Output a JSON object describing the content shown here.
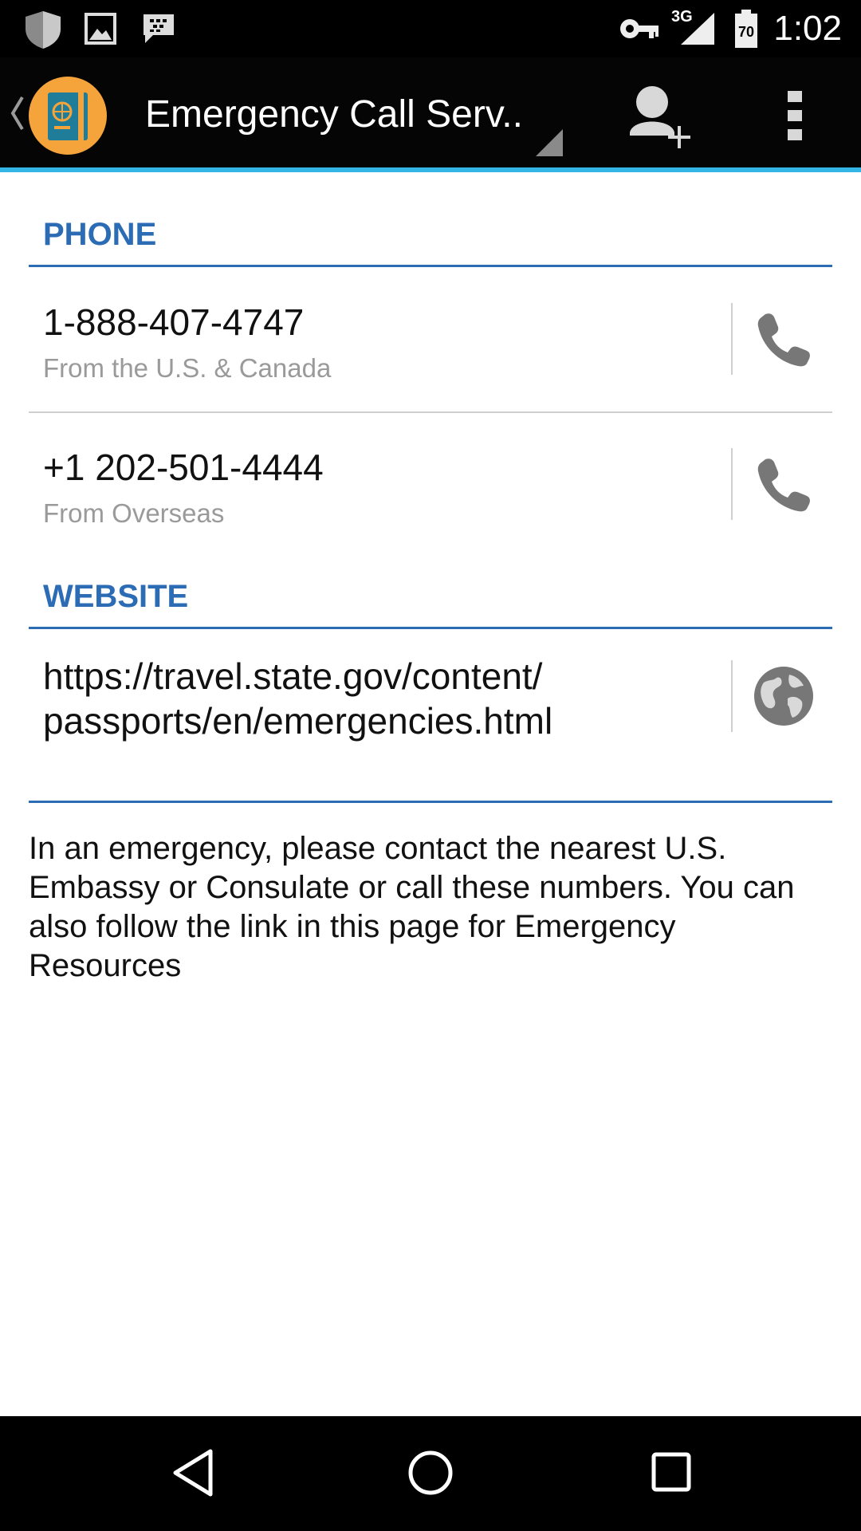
{
  "status_bar": {
    "time": "1:02",
    "network": "3G",
    "battery_level": "70",
    "icons": [
      "shield-icon",
      "image-icon",
      "bbm-icon",
      "key-icon",
      "signal-icon",
      "battery-icon"
    ]
  },
  "action_bar": {
    "title": "Emergency Call Serv..",
    "icons": [
      "back-chevron-icon",
      "passport-app-icon",
      "spinner-indicator-icon",
      "add-contact-icon",
      "overflow-menu-icon"
    ]
  },
  "sections": {
    "phone": {
      "heading": "PHONE",
      "entries": [
        {
          "number": "1-888-407-4747",
          "label": "From the U.S. & Canada"
        },
        {
          "number": "+1 202-501-4444",
          "label": "From Overseas"
        }
      ]
    },
    "website": {
      "heading": "WEBSITE",
      "url_line1": "https://travel.state.gov/content/",
      "url_line2": "passports/en/emergencies.html"
    }
  },
  "note": "In an emergency, please contact the nearest U.S. Embassy or Consulate or call these numbers. You can also follow the link in this page for Emergency Resources",
  "nav_bar": {
    "icons": [
      "back-icon",
      "home-icon",
      "recents-icon"
    ]
  },
  "colors": {
    "accent_blue": "#2b6cb5",
    "action_bar_underline": "#33b5e5",
    "app_icon_orange": "#f5a33b",
    "app_icon_teal": "#1f7d99",
    "secondary_text": "#9a9a9a",
    "icon_gray": "#777777"
  }
}
